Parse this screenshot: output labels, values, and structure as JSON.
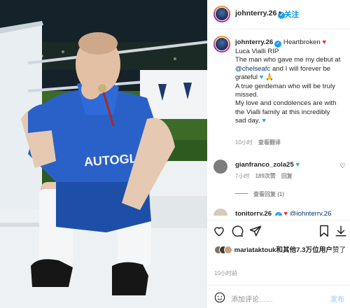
{
  "colors": {
    "accent": "#0095f6",
    "verified": "#1d9bf0",
    "heart": "#ed2b3b",
    "muted": "#8e8e8e"
  },
  "photo": {
    "alt_icon": "image"
  },
  "header": {
    "username": "johnterry.26",
    "follow_label": "关注",
    "separator": "•"
  },
  "caption": {
    "username": "johnterry.26",
    "lines": [
      "Heartbroken",
      "Luca Vialli RIP",
      "The man who gave me my debut at",
      "@chelseafc",
      "and I will forever be",
      "grateful",
      "A true gentleman who will be truly",
      "missed.",
      "My love and condolences are with",
      "the Vialli family at this incredibly",
      "sad day."
    ],
    "age": "10小时",
    "translate": "查看翻译"
  },
  "comments": [
    {
      "username": "gianfranco_zola25",
      "age": "7小时",
      "likes": "189次赞",
      "reply": "回复",
      "view_replies": "查看回复 (1)"
    },
    {
      "username": "tonitorry.26",
      "mention": "@johnterry.26"
    }
  ],
  "actions": {
    "icons": [
      "heart-icon",
      "comment-icon",
      "share-icon",
      "bookmark-icon",
      "download-icon"
    ]
  },
  "likes": {
    "text_prefix": "mariataktouk和",
    "text_bold": "其他7.3万位用户",
    "text_suffix": "赞了"
  },
  "timestamp": "10小时前",
  "composer": {
    "placeholder": "添加评论……",
    "post_label": "发布"
  }
}
